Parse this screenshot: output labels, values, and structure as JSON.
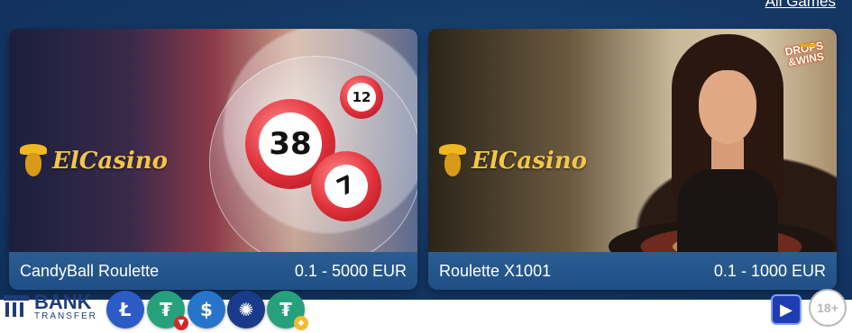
{
  "header": {
    "all_games_label": "All Games"
  },
  "games": [
    {
      "provider": "ElCasino",
      "title": "CandyBall Roulette",
      "limits": "0.1 - 5000 EUR",
      "balls": [
        "38",
        "12",
        "7"
      ]
    },
    {
      "provider": "ElCasino",
      "title": "Roulette X1001",
      "limits": "0.1 - 1000 EUR",
      "badge_top": "DROPS",
      "badge_bottom": "&WINS"
    }
  ],
  "payments": {
    "bank_title": "BANK",
    "bank_sub": "TRANSFER",
    "coins": [
      "litecoin-icon",
      "usdt-trc20-icon",
      "usdc-icon",
      "cardano-icon",
      "usdt-bep20-icon"
    ]
  },
  "footer": {
    "age_label": "18+"
  },
  "colors": {
    "card_footer": "#1f4f85",
    "background": "#163a63",
    "logo_gold": "#f2c54a"
  }
}
